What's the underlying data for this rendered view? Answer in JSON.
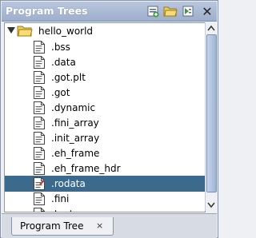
{
  "panel": {
    "title": "Program Trees"
  },
  "toolbar": {
    "create_icon": "create-program-tree-icon",
    "open_icon": "open-folder-icon",
    "tree_icon": "tree-view-icon",
    "close_icon": "close-icon",
    "close_glyph": "✕"
  },
  "tree": {
    "root": {
      "label": "hello_world",
      "expanded": true
    },
    "items": [
      {
        "label": ".bss"
      },
      {
        "label": ".data"
      },
      {
        "label": ".got.plt"
      },
      {
        "label": ".got"
      },
      {
        "label": ".dynamic"
      },
      {
        "label": ".fini_array"
      },
      {
        "label": ".init_array"
      },
      {
        "label": ".eh_frame"
      },
      {
        "label": ".eh_frame_hdr"
      },
      {
        "label": ".rodata",
        "selected": true
      },
      {
        "label": ".fini"
      },
      {
        "label": ".text"
      }
    ]
  },
  "tabs": [
    {
      "label": "Program Tree",
      "close": "×"
    }
  ],
  "colors": {
    "selection": "#3c6a8d",
    "titlebar": "#a9b8d4"
  }
}
